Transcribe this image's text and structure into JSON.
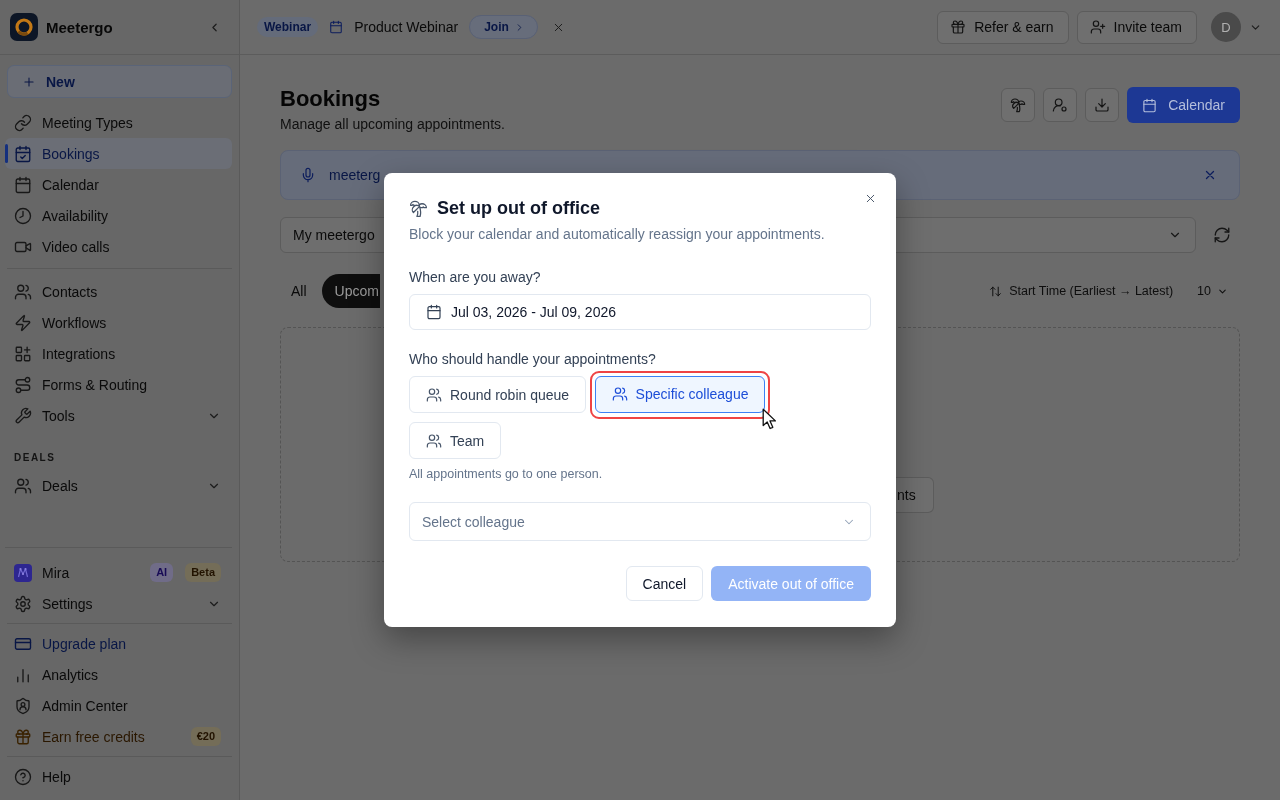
{
  "sidebar": {
    "brand": "Meetergo",
    "new_button": "New",
    "top_groups": [
      {
        "items": [
          {
            "label": "Meeting Types",
            "kind": "link",
            "selected": false
          },
          {
            "label": "Bookings",
            "kind": "link",
            "selected": true
          },
          {
            "label": "Calendar",
            "kind": "link",
            "selected": false
          },
          {
            "label": "Availability",
            "kind": "link",
            "selected": false
          },
          {
            "label": "Video calls",
            "kind": "link",
            "selected": false
          }
        ]
      },
      {
        "items": [
          {
            "label": "Contacts",
            "kind": "link",
            "selected": false
          },
          {
            "label": "Workflows",
            "kind": "link",
            "selected": false
          },
          {
            "label": "Integrations",
            "kind": "link",
            "selected": false
          },
          {
            "label": "Forms & Routing",
            "kind": "link",
            "selected": false
          },
          {
            "label": "Tools",
            "kind": "group",
            "selected": false
          }
        ]
      },
      {
        "heading": "DEALS",
        "items": [
          {
            "label": "Deals",
            "kind": "group",
            "selected": false
          }
        ]
      }
    ],
    "bottom_groups": [
      {
        "items": [
          {
            "label": "Mira",
            "kind": "link",
            "selected": false,
            "badges": [
              {
                "label": "AI",
                "kind": "ai"
              },
              {
                "label": "Beta",
                "kind": "beta"
              }
            ]
          },
          {
            "label": "Settings",
            "kind": "group",
            "selected": false
          }
        ]
      },
      {
        "items": [
          {
            "label": "Upgrade plan",
            "kind": "upgrade",
            "selected": false
          },
          {
            "label": "Analytics",
            "kind": "link",
            "selected": false
          },
          {
            "label": "Admin Center",
            "kind": "link",
            "selected": false
          },
          {
            "label": "Earn free credits",
            "kind": "reward",
            "selected": false,
            "badges": [
              {
                "label": "€20",
                "kind": "credit"
              }
            ]
          }
        ]
      },
      {
        "items": [
          {
            "label": "Help",
            "kind": "link",
            "selected": false
          }
        ]
      }
    ]
  },
  "top_bar": {
    "event_badge": "Webinar",
    "event_title": "Product Webinar",
    "join_button": "Join",
    "actions": [
      "Refer & earn",
      "Invite team"
    ],
    "avatar_initial": "D"
  },
  "page": {
    "title": "Bookings",
    "subtitle": "Manage all upcoming appointments.",
    "primary_button": "Calendar",
    "banner": {
      "text": "meeterg"
    },
    "filter": {
      "value": "My meetergo"
    },
    "tabs": [
      {
        "label": "All",
        "selected": false
      },
      {
        "label": "Upcom",
        "selected": true
      }
    ],
    "sort": {
      "label": "Start Time (Earliest → Latest)",
      "page_size": "10"
    },
    "empty_state": {
      "button": "nts"
    }
  },
  "dialog": {
    "title": "Set up out of office",
    "subtitle": "Block your calendar and automatically reassign your appointments.",
    "date_label": "When are you away?",
    "date_field": {
      "value": "Jul 03, 2026 - Jul 09, 2026"
    },
    "handler_label": "Who should handle your appointments?",
    "options": [
      {
        "label": "Round robin queue",
        "selected": false,
        "highlighted": false
      },
      {
        "label": "Specific colleague",
        "selected": true,
        "highlighted": true
      },
      {
        "label": "Team",
        "selected": false,
        "highlighted": false
      }
    ],
    "hint": "All appointments go to one person.",
    "colleague_select": {
      "placeholder": "Select colleague"
    },
    "buttons": [
      {
        "label": "Cancel",
        "kind": "secondary",
        "disabled": false
      },
      {
        "label": "Activate out of office",
        "kind": "primary",
        "disabled": true
      }
    ]
  }
}
